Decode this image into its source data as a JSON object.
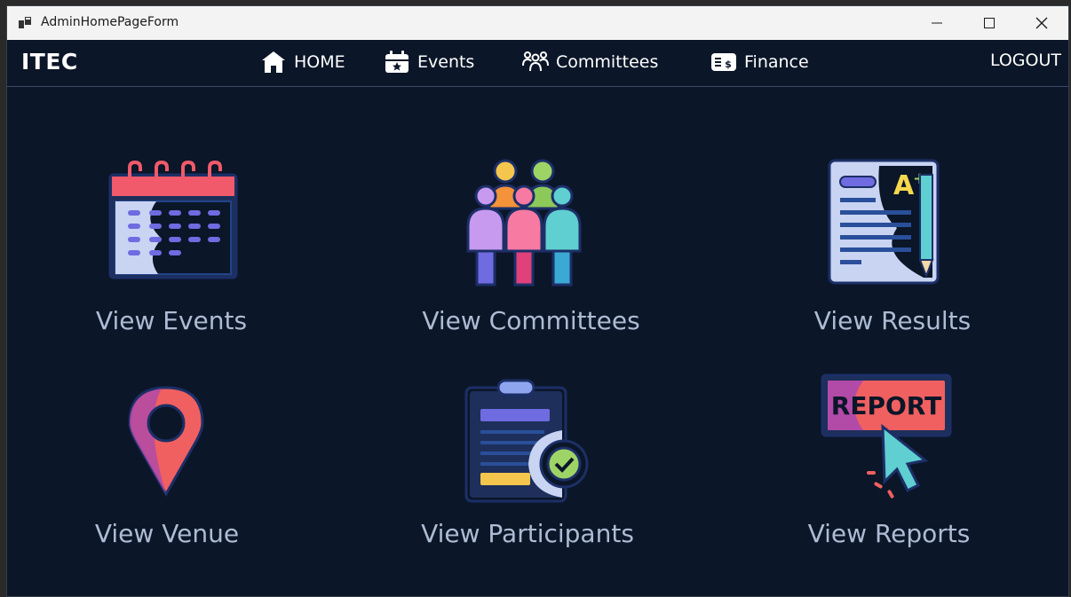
{
  "window": {
    "title": "AdminHomePageForm"
  },
  "navbar": {
    "brand": "ITEC",
    "items": [
      {
        "label": "HOME",
        "icon": "home-icon"
      },
      {
        "label": "Events",
        "icon": "calendar-icon"
      },
      {
        "label": "Committees",
        "icon": "people-icon"
      },
      {
        "label": "Finance",
        "icon": "finance-icon"
      }
    ],
    "logout": "LOGOUT"
  },
  "tiles": [
    {
      "label": "View Events",
      "icon": "calendar-icon"
    },
    {
      "label": "View Committees",
      "icon": "committee-people-icon"
    },
    {
      "label": "View Results",
      "icon": "graded-paper-icon"
    },
    {
      "label": "View Venue",
      "icon": "location-pin-icon"
    },
    {
      "label": "View Participants",
      "icon": "clipboard-check-icon"
    },
    {
      "label": "View Reports",
      "icon": "report-cursor-icon",
      "icon_text": "REPORT"
    }
  ],
  "colors": {
    "background": "#0b1628",
    "label": "#aebbd4",
    "titlebar": "#f3f3f3"
  }
}
